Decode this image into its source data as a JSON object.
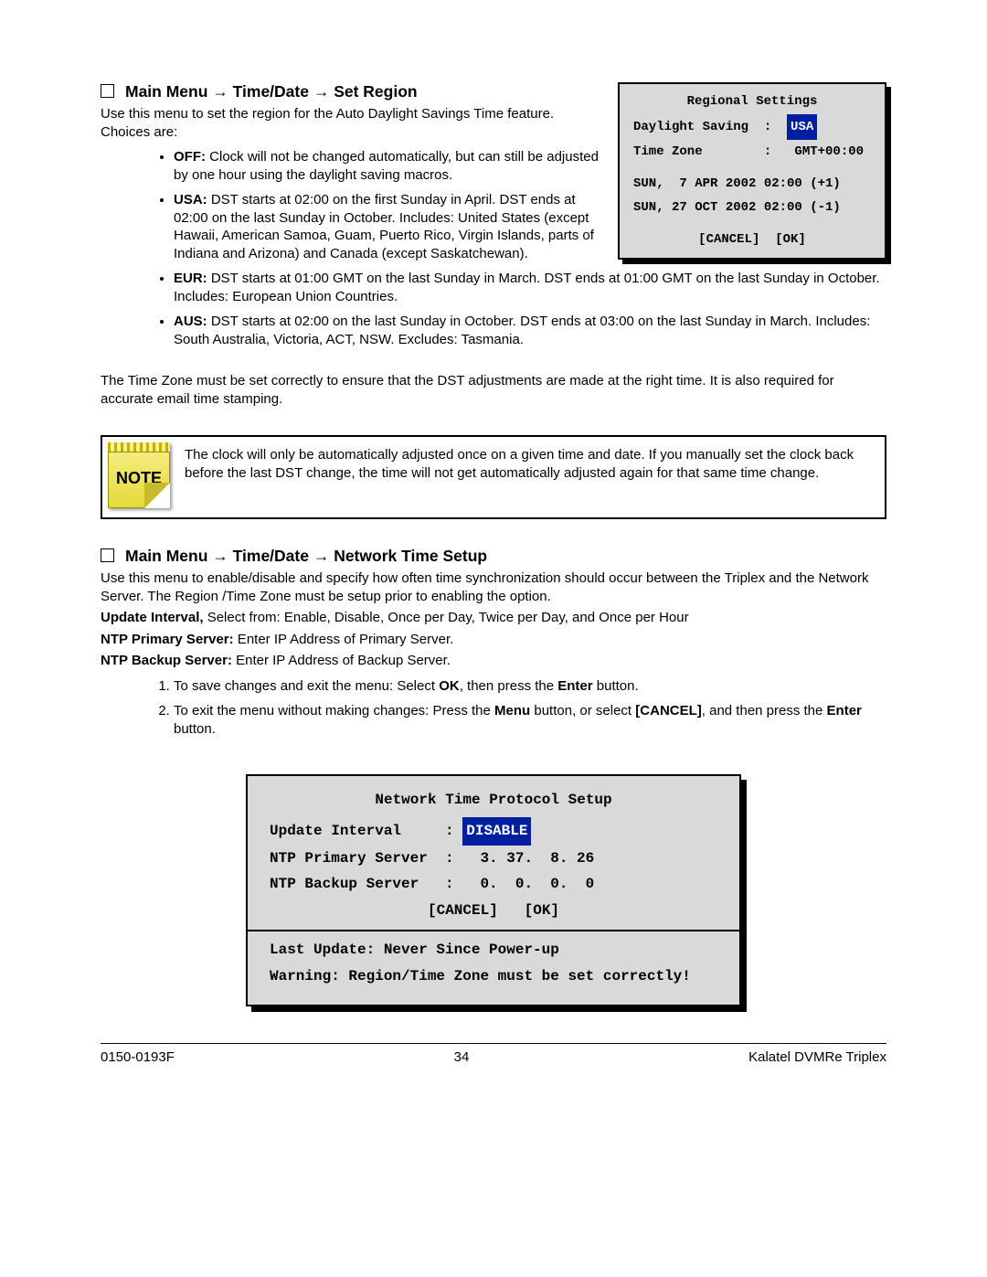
{
  "section1": {
    "heading_prefix": "Main Menu ",
    "heading_mid": " Time/Date ",
    "heading_suffix": " Set Region",
    "intro": "Use this menu to set the region for the Auto Daylight Savings Time feature. Choices are:",
    "bullets": {
      "off_label": "OFF:",
      "off_text": " Clock will not be changed automatically, but can still be adjusted by one hour using the daylight saving macros.",
      "usa_label": "USA:",
      "usa_text": " DST starts at 02:00 on the first Sunday in April. DST ends at 02:00 on the last Sunday in October. Includes: United States (except Hawaii, American Samoa, Guam, Puerto Rico, Virgin Islands, parts of Indiana and Arizona) and Canada (except Saskatchewan).",
      "eur_label": "EUR:",
      "eur_text": " DST starts at 01:00 GMT on the last Sunday in March. DST ends at 01:00 GMT on the last Sunday in October. Includes: European Union Countries.",
      "aus_label": "AUS:",
      "aus_text": " DST starts at 02:00 on the last Sunday in October. DST ends at 03:00 on the last Sunday in March. Includes: South Australia, Victoria, ACT, NSW. Excludes: Tasmania."
    },
    "tz_note": "The Time Zone must be set correctly to ensure that the DST adjustments are made at the right time. It is also required for accurate email time stamping."
  },
  "regional_panel": {
    "title": "Regional Settings",
    "row1_label": "Daylight Saving  :",
    "row1_value": "USA",
    "row2": "Time Zone        :   GMT+00:00",
    "row3": "SUN,  7 APR 2002 02:00 (+1)",
    "row4": "SUN, 27 OCT 2002 02:00 (-1)",
    "cancel": "[CANCEL]",
    "ok": "[OK]"
  },
  "note": {
    "icon_label": "NOTE",
    "text": "The clock will only be automatically adjusted once on a given time and date. If you manually set the clock back before the last DST change, the time will not get automatically adjusted again for that same time change."
  },
  "section2": {
    "heading_prefix": "Main Menu ",
    "heading_mid": " Time/Date ",
    "heading_suffix": " Network Time Setup",
    "intro": "Use this menu to enable/disable and specify how often time synchronization should occur between the Triplex and the Network Server. The Region /Time Zone must be setup prior to enabling the option.",
    "update_interval_label": "Update Interval,",
    "update_interval_text": " Select from: Enable, Disable, Once per Day, Twice per Day, and Once per Hour",
    "primary_label": "NTP Primary Server:",
    "primary_text": " Enter IP Address of Primary Server.",
    "backup_label": "NTP Backup Server:",
    "backup_text": " Enter IP Address of Backup Server.",
    "step1_a": "To save changes and exit the menu:  Select ",
    "step1_b": "OK",
    "step1_c": ", then press the ",
    "step1_d": "Enter",
    "step1_e": " button.",
    "step2_a": "To exit the menu without making changes:  Press the ",
    "step2_b": "Menu",
    "step2_c": " button, or select ",
    "step2_d": "[CANCEL]",
    "step2_e": ", and then press the ",
    "step2_f": "Enter",
    "step2_g": " button."
  },
  "ntp_panel": {
    "title": "Network Time Protocol Setup",
    "row1_label": "Update Interval     : ",
    "row1_value": "DISABLE",
    "row2": "NTP Primary Server  :   3. 37.  8. 26",
    "row3": "NTP Backup Server   :   0.  0.  0.  0",
    "cancel": "[CANCEL]",
    "ok": "[OK]",
    "last": "Last Update: Never Since Power-up",
    "warn": "Warning: Region/Time Zone must be set correctly!"
  },
  "footer": {
    "left": "0150-0193F",
    "center": "34",
    "right": "Kalatel DVMRe Triplex"
  },
  "glyphs": {
    "arrow": "→"
  }
}
